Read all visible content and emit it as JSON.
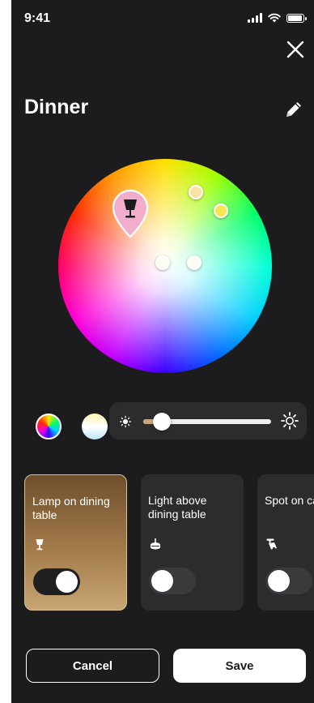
{
  "status_bar": {
    "time": "9:41"
  },
  "header": {
    "title": "Dinner"
  },
  "brightness": {
    "level": 0.12
  },
  "lights": [
    {
      "name": "Lamp on dining table",
      "icon": "table-lamp-icon",
      "on": true
    },
    {
      "name": "Light above dining table",
      "icon": "pendant-light-icon",
      "on": false
    },
    {
      "name": "Spot on cabinet",
      "icon": "spot-light-icon",
      "on": false
    }
  ],
  "actions": {
    "cancel_label": "Cancel",
    "save_label": "Save"
  },
  "colors": {
    "background": "#1c1c1e",
    "active_card": "#a37b4a",
    "card": "#2c2c2e"
  }
}
